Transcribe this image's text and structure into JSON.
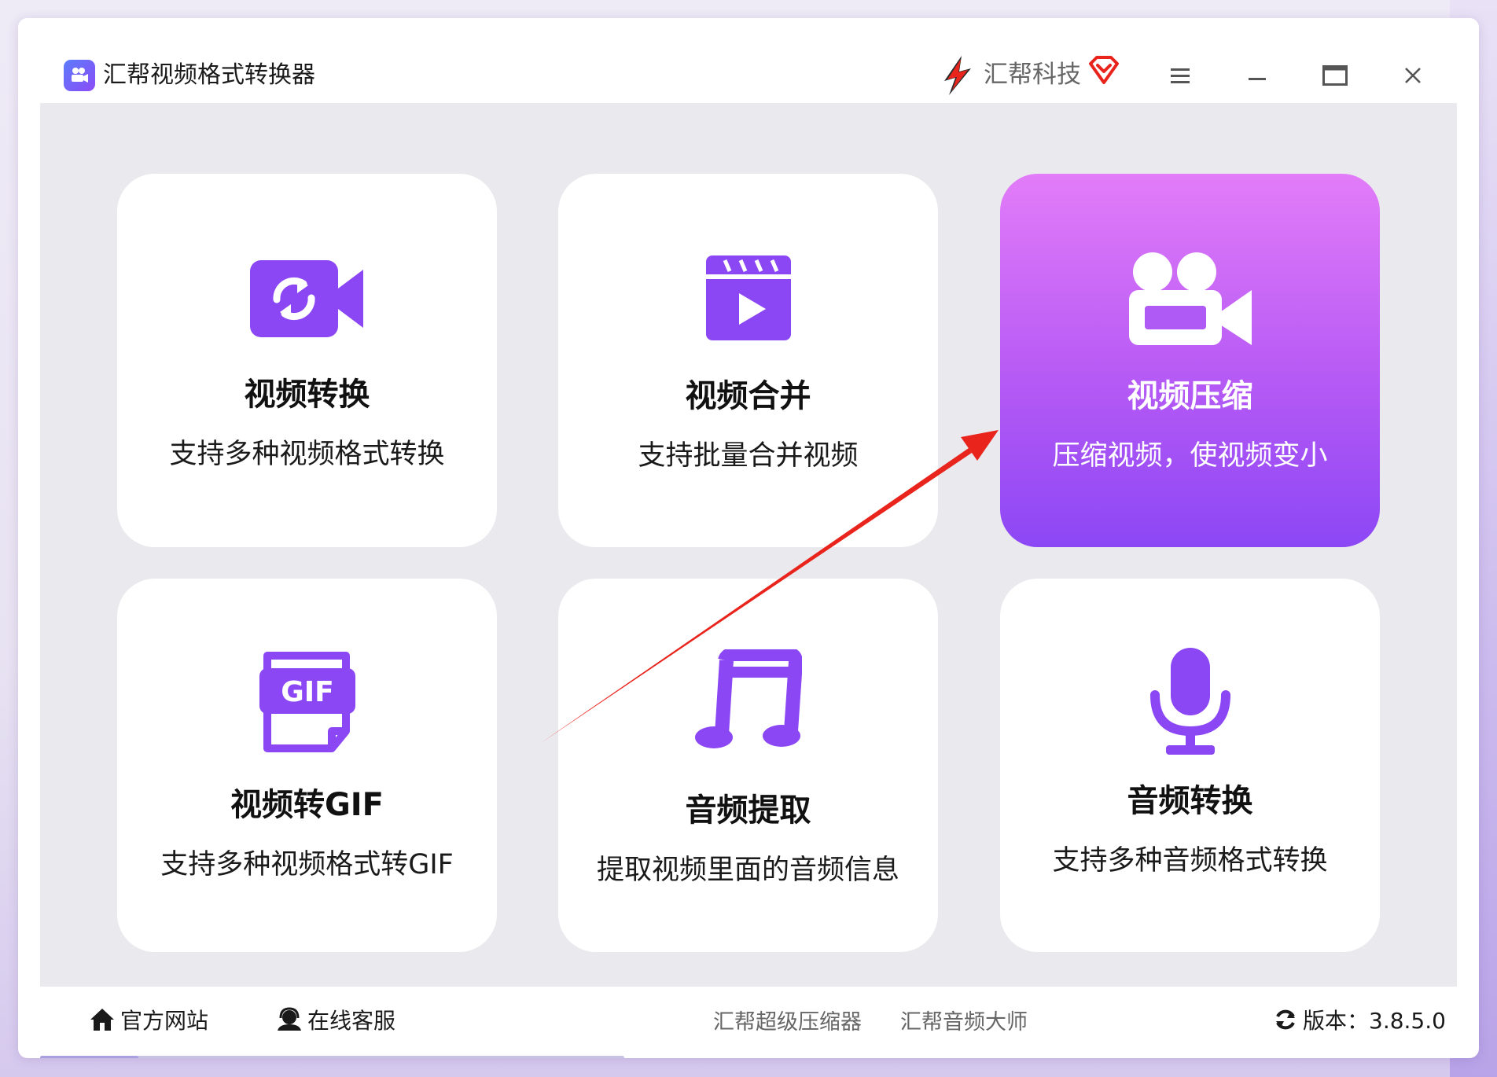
{
  "window": {
    "title": "汇帮视频格式转换器",
    "brand": "汇帮科技"
  },
  "cards": [
    {
      "title": "视频转换",
      "desc": "支持多种视频格式转换",
      "icon": "video-convert-icon"
    },
    {
      "title": "视频合并",
      "desc": "支持批量合并视频",
      "icon": "clapperboard-play-icon"
    },
    {
      "title": "视频压缩",
      "desc": "压缩视频，使视频变小",
      "icon": "movie-camera-icon",
      "active": true
    },
    {
      "title": "视频转GIF",
      "desc": "支持多种视频格式转GIF",
      "icon": "gif-file-icon"
    },
    {
      "title": "音频提取",
      "desc": "提取视频里面的音频信息",
      "icon": "music-note-icon"
    },
    {
      "title": "音频转换",
      "desc": "支持多种音频格式转换",
      "icon": "microphone-icon"
    }
  ],
  "footer": {
    "website": "官方网站",
    "service": "在线客服",
    "link1": "汇帮超级压缩器",
    "link2": "汇帮音频大师",
    "version": "版本：3.8.5.0"
  },
  "colors": {
    "accent": "#8c47f5",
    "active_gradient_top": "#e27cf8",
    "annotation_arrow": "#e8241c"
  }
}
